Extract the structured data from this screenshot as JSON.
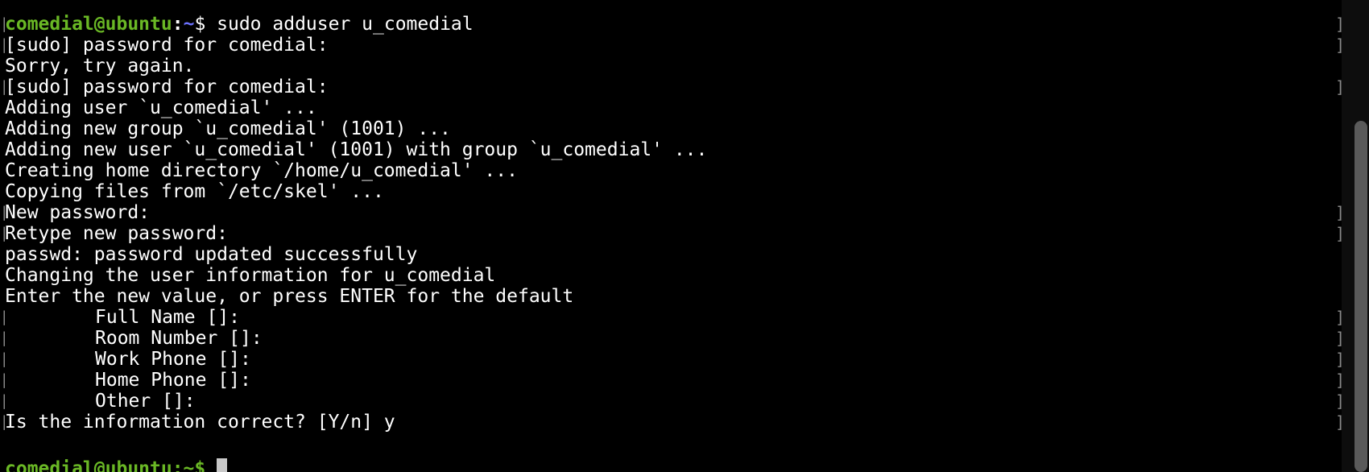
{
  "prompt": {
    "user_host": "comedial@ubuntu",
    "separator": ":",
    "path": "~",
    "dollar": "$ ",
    "command": "sudo adduser u_comedial",
    "last_partial": "comedial@ubuntu:~$ "
  },
  "lines": {
    "l1": "[sudo] password for comedial:",
    "l2": "Sorry, try again.",
    "l3": "[sudo] password for comedial:",
    "l4": "Adding user `u_comedial' ...",
    "l5": "Adding new group `u_comedial' (1001) ...",
    "l6": "Adding new user `u_comedial' (1001) with group `u_comedial' ...",
    "l7": "Creating home directory `/home/u_comedial' ...",
    "l8": "Copying files from `/etc/skel' ...",
    "l9": "New password:",
    "l10": "Retype new password:",
    "l11": "passwd: password updated successfully",
    "l12": "Changing the user information for u_comedial",
    "l13": "Enter the new value, or press ENTER for the default",
    "l14": "Full Name []:",
    "l15": "Room Number []:",
    "l16": "Work Phone []:",
    "l17": "Home Phone []:",
    "l18": "Other []:",
    "l19": "Is the information correct? [Y/n] y"
  },
  "brackets": {
    "left": "[",
    "right": "]"
  },
  "colors": {
    "background": "#000000",
    "text": "#ffffff",
    "prompt_user": "#6ab825",
    "prompt_path": "#6c71ff"
  }
}
